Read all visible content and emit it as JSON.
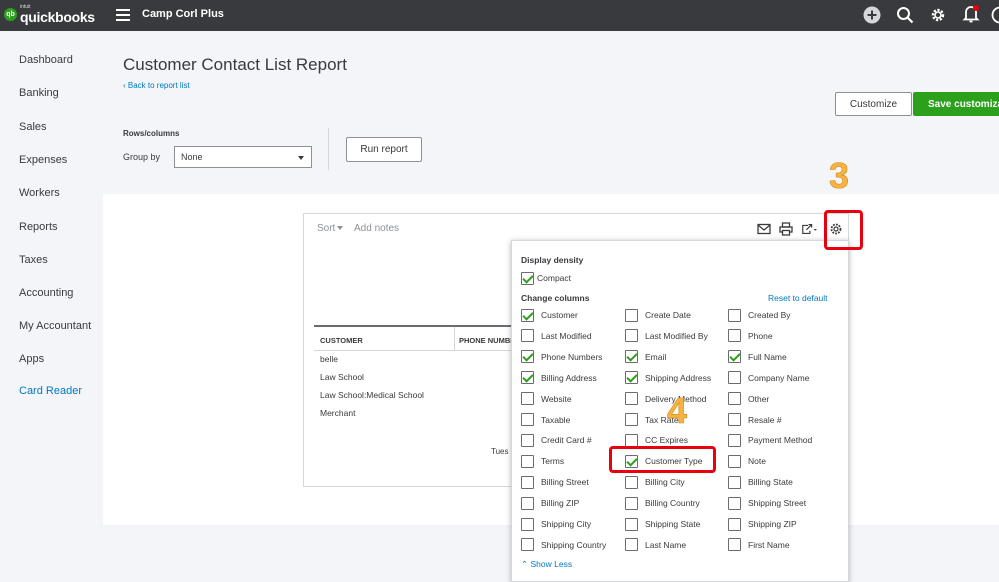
{
  "topbar": {
    "logo_small": "intuit",
    "logo_main": "quickbooks",
    "logo_mark": "qb",
    "company": "Camp Corl Plus",
    "icons": [
      "plus-icon",
      "search-icon",
      "gear-icon",
      "bell-icon",
      "help-icon"
    ]
  },
  "sidebar": {
    "items": [
      {
        "label": "Dashboard"
      },
      {
        "label": "Banking"
      },
      {
        "label": "Sales"
      },
      {
        "label": "Expenses"
      },
      {
        "label": "Workers"
      },
      {
        "label": "Reports"
      },
      {
        "label": "Taxes"
      },
      {
        "label": "Accounting"
      },
      {
        "label": "My Accountant"
      },
      {
        "label": "Apps"
      },
      {
        "label": "Card Reader"
      }
    ]
  },
  "header": {
    "title": "Customer Contact List Report",
    "back_link": "Back to report list",
    "customize_label": "Customize",
    "save_label": "Save customizati"
  },
  "controls": {
    "rows_columns_label": "Rows/columns",
    "group_by_label": "Group by",
    "group_by_value": "None",
    "run_report_label": "Run report"
  },
  "report": {
    "sort_label": "Sort",
    "add_notes_label": "Add notes",
    "columns": [
      "CUSTOMER",
      "PHONE NUMBE"
    ],
    "rows": [
      "belle",
      "Law School",
      "Law School:Medical School",
      "Merchant"
    ],
    "footer_partial": "Tues"
  },
  "popup": {
    "display_density_label": "Display density",
    "compact": {
      "label": "Compact",
      "checked": true
    },
    "change_columns_label": "Change columns",
    "reset_label": "Reset to default",
    "options": [
      [
        {
          "label": "Customer",
          "checked": true
        },
        {
          "label": "Create Date",
          "checked": false
        },
        {
          "label": "Created By",
          "checked": false
        }
      ],
      [
        {
          "label": "Last Modified",
          "checked": false
        },
        {
          "label": "Last Modified By",
          "checked": false
        },
        {
          "label": "Phone",
          "checked": false
        }
      ],
      [
        {
          "label": "Phone Numbers",
          "checked": true
        },
        {
          "label": "Email",
          "checked": true
        },
        {
          "label": "Full Name",
          "checked": true
        }
      ],
      [
        {
          "label": "Billing Address",
          "checked": true
        },
        {
          "label": "Shipping Address",
          "checked": true
        },
        {
          "label": "Company Name",
          "checked": false
        }
      ],
      [
        {
          "label": "Website",
          "checked": false
        },
        {
          "label": "Delivery Method",
          "checked": false
        },
        {
          "label": "Other",
          "checked": false
        }
      ],
      [
        {
          "label": "Taxable",
          "checked": false
        },
        {
          "label": "Tax Rate",
          "checked": false
        },
        {
          "label": "Resale #",
          "checked": false
        }
      ],
      [
        {
          "label": "Credit Card #",
          "checked": false
        },
        {
          "label": "CC Expires",
          "checked": false
        },
        {
          "label": "Payment Method",
          "checked": false
        }
      ],
      [
        {
          "label": "Terms",
          "checked": false
        },
        {
          "label": "Customer Type",
          "checked": true
        },
        {
          "label": "Note",
          "checked": false
        }
      ],
      [
        {
          "label": "Billing Street",
          "checked": false
        },
        {
          "label": "Billing City",
          "checked": false
        },
        {
          "label": "Billing State",
          "checked": false
        }
      ],
      [
        {
          "label": "Billing ZIP",
          "checked": false
        },
        {
          "label": "Billing Country",
          "checked": false
        },
        {
          "label": "Shipping Street",
          "checked": false
        }
      ],
      [
        {
          "label": "Shipping City",
          "checked": false
        },
        {
          "label": "Shipping State",
          "checked": false
        },
        {
          "label": "Shipping ZIP",
          "checked": false
        }
      ],
      [
        {
          "label": "Shipping Country",
          "checked": false
        },
        {
          "label": "Last Name",
          "checked": false
        },
        {
          "label": "First Name",
          "checked": false
        }
      ]
    ],
    "show_less_label": "Show Less"
  },
  "annotations": {
    "step_3": "3",
    "step_4": "4"
  },
  "colors": {
    "topbar": "#393a3d",
    "brand_green": "#2ca01c",
    "link_blue": "#0077c5",
    "annotation_red": "#e8000d",
    "annotation_orange": "#f7b241"
  }
}
